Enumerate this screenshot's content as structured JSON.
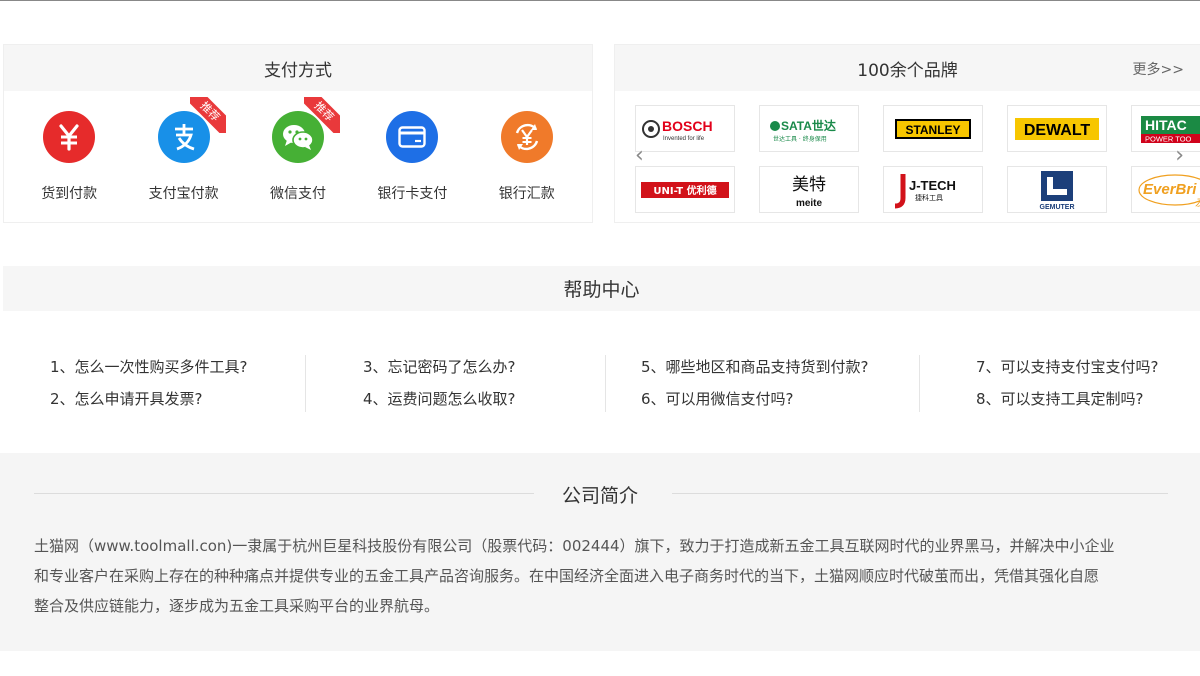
{
  "payment": {
    "title": "支付方式",
    "methods": [
      {
        "label": "货到付款",
        "icon": "yen-icon",
        "color": "#e62b2b",
        "recommended": false
      },
      {
        "label": "支付宝付款",
        "icon": "alipay-icon",
        "color": "#1890e8",
        "recommended": true
      },
      {
        "label": "微信支付",
        "icon": "wechat-icon",
        "color": "#46b035",
        "recommended": true
      },
      {
        "label": "银行卡支付",
        "icon": "bank-card-icon",
        "color": "#1e6fe6",
        "recommended": false
      },
      {
        "label": "银行汇款",
        "icon": "remittance-icon",
        "color": "#f07a2a",
        "recommended": false
      }
    ],
    "recommend_tag": "推荐"
  },
  "brands": {
    "title": "100余个品牌",
    "more": "更多>>",
    "row1": [
      {
        "name": "BOSCH",
        "sub": "Invented for life"
      },
      {
        "name": "SATA世达",
        "sub": "世达工具 · 终身保用"
      },
      {
        "name": "STANLEY"
      },
      {
        "name": "DEWALT"
      },
      {
        "name": "HITAC",
        "sub": "POWER TOO"
      }
    ],
    "row2": [
      {
        "name": "UNI-T 优利德"
      },
      {
        "name": "美特",
        "sub": "meite"
      },
      {
        "name": "J-TECH",
        "sub": "捷科工具"
      },
      {
        "name": "GEMUTER"
      },
      {
        "name": "EverBri",
        "sub": "友"
      }
    ]
  },
  "help": {
    "title": "帮助中心",
    "columns": [
      [
        "1、怎么一次性购买多件工具?",
        "2、怎么申请开具发票?"
      ],
      [
        "3、忘记密码了怎么办?",
        "4、运费问题怎么收取?"
      ],
      [
        "5、哪些地区和商品支持货到付款?",
        "6、可以用微信支付吗?"
      ],
      [
        "7、可以支持支付宝支付吗?",
        "8、可以支持工具定制吗?"
      ]
    ]
  },
  "about": {
    "title": "公司简介",
    "lines": [
      "土猫网（www.toolmall.con)一隶属于杭州巨星科技股份有限公司（股票代码：002444）旗下，致力于打造成新五金工具互联网时代的业界黑马，并解决中小企业",
      "和专业客户在采购上存在的种种痛点并提供专业的五金工具产品咨询服务。在中国经济全面进入电子商务时代的当下，土猫网顺应时代破茧而出，凭借其强化自愿",
      "整合及供应链能力，逐步成为五金工具采购平台的业界航母。"
    ]
  }
}
